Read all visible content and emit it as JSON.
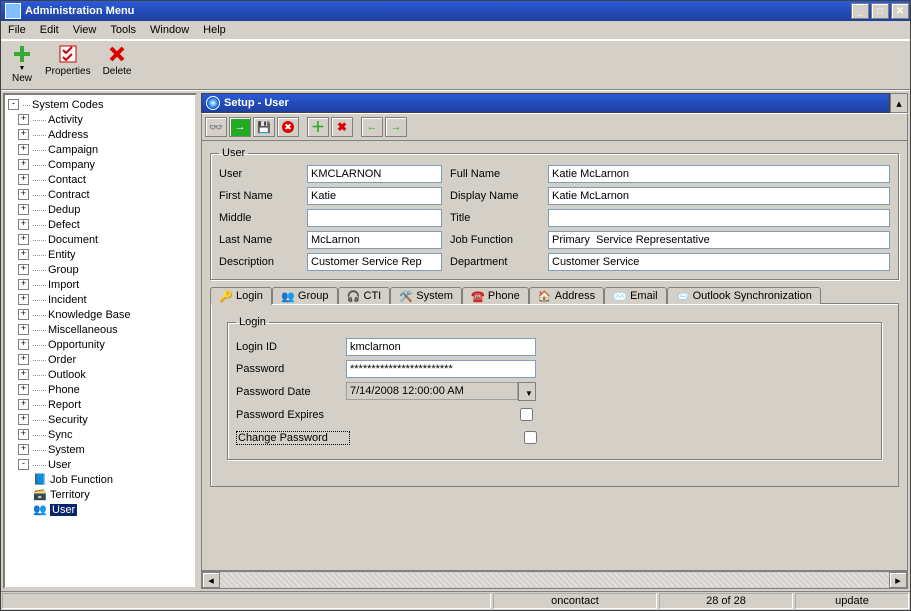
{
  "window": {
    "title": "Administration Menu"
  },
  "menu": {
    "file": "File",
    "edit": "Edit",
    "view": "View",
    "tools": "Tools",
    "window": "Window",
    "help": "Help"
  },
  "toolbar": {
    "new": "New",
    "properties": "Properties",
    "delete": "Delete"
  },
  "tree": {
    "root": "System Codes",
    "items": [
      "Activity",
      "Address",
      "Campaign",
      "Company",
      "Contact",
      "Contract",
      "Dedup",
      "Defect",
      "Document",
      "Entity",
      "Group",
      "Import",
      "Incident",
      "Knowledge Base",
      "Miscellaneous",
      "Opportunity",
      "Order",
      "Outlook",
      "Phone",
      "Report",
      "Security",
      "Sync",
      "System",
      "User"
    ],
    "user_children": {
      "job_function": "Job Function",
      "territory": "Territory",
      "user": "User"
    }
  },
  "panel": {
    "title": "Setup - User",
    "group_user": "User",
    "labels": {
      "user": "User",
      "full_name": "Full Name",
      "first_name": "First Name",
      "display_name": "Display Name",
      "middle": "Middle",
      "title": "Title",
      "last_name": "Last Name",
      "job_function": "Job Function",
      "description": "Description",
      "department": "Department"
    },
    "values": {
      "user": "KMCLARNON",
      "full_name": "Katie McLarnon",
      "first_name": "Katie",
      "display_name": "Katie McLarnon",
      "middle": "",
      "title": "",
      "last_name": "McLarnon",
      "job_function": "Primary  Service Representative",
      "description": "Customer Service Rep",
      "department": "Customer Service"
    }
  },
  "tabs": {
    "login": "Login",
    "group": "Group",
    "cti": "CTI",
    "system": "System",
    "phone": "Phone",
    "address": "Address",
    "email": "Email",
    "outlook": "Outlook Synchronization"
  },
  "login": {
    "legend": "Login",
    "labels": {
      "login_id": "Login ID",
      "password": "Password",
      "password_date": "Password Date",
      "password_expires": "Password Expires",
      "change_password": "Change Password"
    },
    "values": {
      "login_id": "kmclarnon",
      "password": "************************",
      "password_date": "7/14/2008 12:00:00 AM",
      "password_expires": false,
      "change_password": false
    }
  },
  "status": {
    "oncontact": "oncontact",
    "paging": "28 of 28",
    "mode": "update"
  }
}
